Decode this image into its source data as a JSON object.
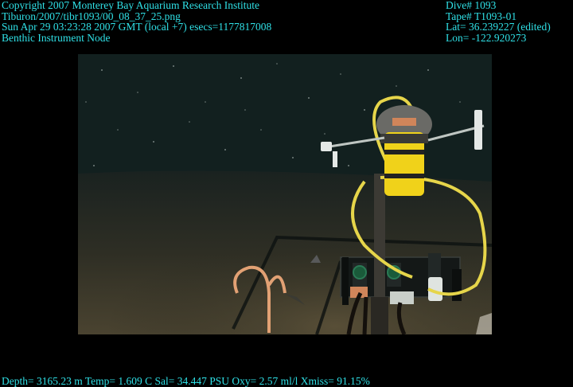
{
  "header_left": {
    "copyright": "Copyright 2007 Monterey Bay Aquarium Research Institute",
    "file_path": "Tiburon/2007/tibr1093/00_08_37_25.png",
    "datetime": "Sun Apr 29 03:23:28 2007 GMT (local +7)  esecs=1177817008",
    "subject": "Benthic Instrument Node"
  },
  "header_right": {
    "dive": "Dive# 1093",
    "tape": "Tape# T1093-01",
    "lat": "Lat= 36.239227 (edited)",
    "lon": "Lon= -122.920273"
  },
  "telemetry": {
    "text": "Depth= 3165.23 m  Temp= 1.609 C  Sal= 34.447 PSU  Oxy= 2.57 ml/l  Xmiss= 91.15%"
  },
  "colors": {
    "overlay_text": "#2fe0e6",
    "background": "#000000",
    "seafloor": "#3f3a2a",
    "water": "#13201f",
    "instrument_yellow": "#f0d21a",
    "cable_yellow": "#e8d84a",
    "hose_orange": "#e0a070"
  }
}
